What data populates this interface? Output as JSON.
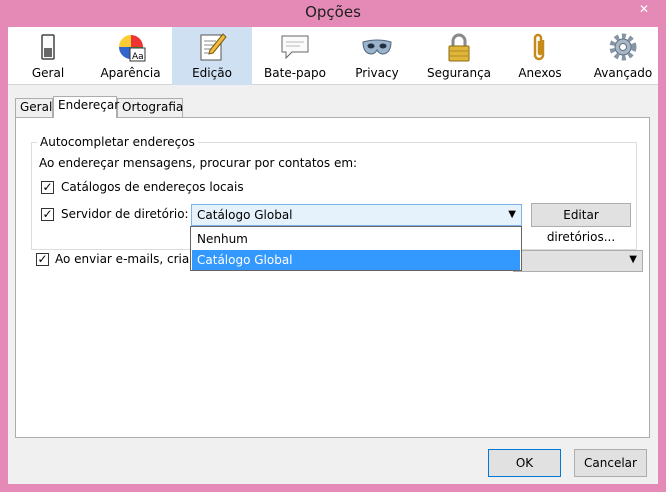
{
  "window": {
    "title": "Opções",
    "close_glyph": "✕"
  },
  "toolbar": {
    "items": [
      {
        "label": "Geral",
        "icon": "switch-icon"
      },
      {
        "label": "Aparência",
        "icon": "palette-icon"
      },
      {
        "label": "Edição",
        "icon": "edit-icon",
        "selected": true
      },
      {
        "label": "Bate-papo",
        "icon": "chat-icon"
      },
      {
        "label": "Privacy",
        "icon": "mask-icon"
      },
      {
        "label": "Segurança",
        "icon": "padlock-icon"
      },
      {
        "label": "Anexos",
        "icon": "paperclip-icon"
      },
      {
        "label": "Avançado",
        "icon": "gear-icon"
      }
    ]
  },
  "tabs": [
    "Geral",
    "Endereçar",
    "Ortografia"
  ],
  "active_tab": "Endereçar",
  "autocomplete": {
    "legend": "Autocompletar endereços",
    "intro": "Ao endereçar mensagens, procurar por contatos em:",
    "local_label": "Catálogos de endereços locais",
    "local_checked": true,
    "server_label": "Servidor de diretório:",
    "server_checked": true,
    "server_value": "Catálogo Global",
    "edit_button": "Editar diretórios...",
    "options": [
      "Nenhum",
      "Catálogo Global"
    ]
  },
  "send": {
    "label": "Ao enviar e-mails, criar c",
    "checked": true
  },
  "buttons": {
    "ok": "OK",
    "cancel": "Cancelar"
  },
  "colors": {
    "title_bar": "#e58ab6",
    "selection": "#3399ff",
    "selected_tab": "#cfe0f3"
  }
}
